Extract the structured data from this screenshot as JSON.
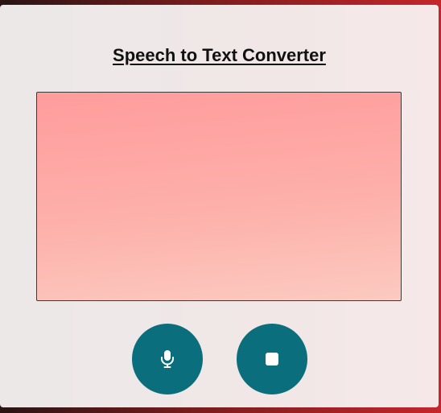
{
  "app": {
    "title": "Speech to Text Converter"
  },
  "transcript": {
    "value": "",
    "placeholder": ""
  },
  "controls": {
    "start": {
      "icon": "microphone-icon"
    },
    "stop": {
      "icon": "stop-icon"
    }
  },
  "colors": {
    "button": "#0b6e7c",
    "textarea_top": "#ff9c9c",
    "textarea_bottom": "#fbcac0",
    "card": "#efe8e8"
  }
}
